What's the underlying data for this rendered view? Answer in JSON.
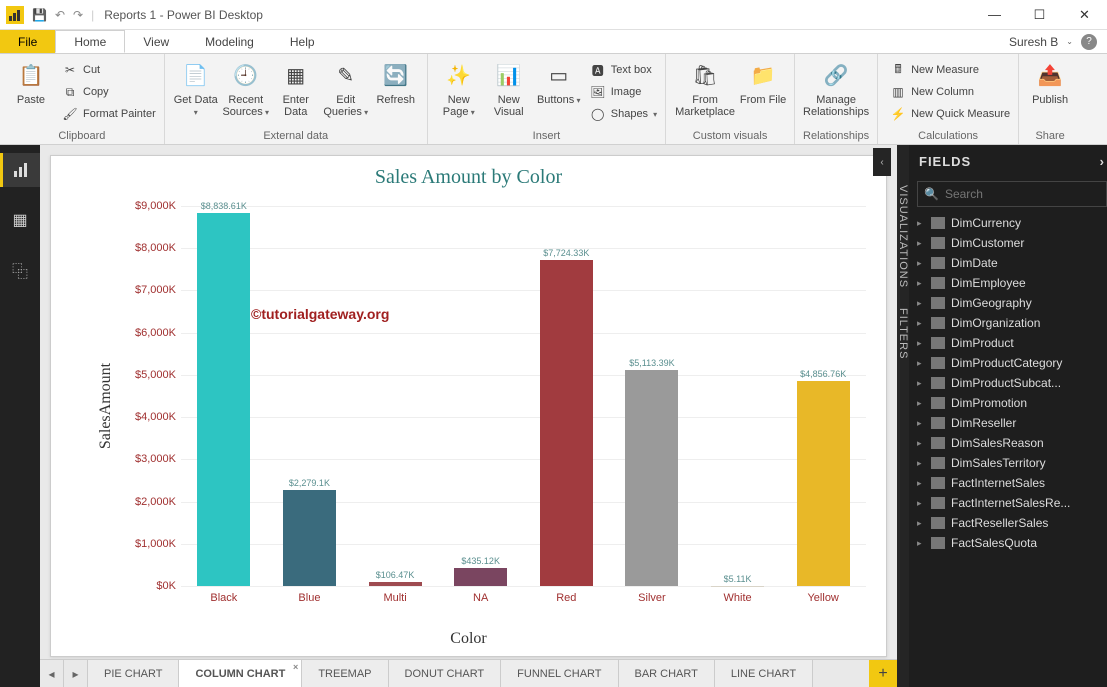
{
  "title": "Reports 1 - Power BI Desktop",
  "user": "Suresh B",
  "menu": {
    "file": "File",
    "tabs": [
      "Home",
      "View",
      "Modeling",
      "Help"
    ],
    "active": "Home"
  },
  "ribbon": {
    "clipboard": {
      "label": "Clipboard",
      "paste": "Paste",
      "cut": "Cut",
      "copy": "Copy",
      "painter": "Format Painter"
    },
    "external": {
      "label": "External data",
      "get": "Get Data",
      "recent": "Recent Sources",
      "enter": "Enter Data",
      "edit": "Edit Queries",
      "refresh": "Refresh"
    },
    "insert": {
      "label": "Insert",
      "page": "New Page",
      "visual": "New Visual",
      "buttons": "Buttons",
      "textbox": "Text box",
      "image": "Image",
      "shapes": "Shapes"
    },
    "custom": {
      "label": "Custom visuals",
      "market": "From Marketplace",
      "file": "From File"
    },
    "rel": {
      "label": "Relationships",
      "manage": "Manage Relationships"
    },
    "calc": {
      "label": "Calculations",
      "measure": "New Measure",
      "column": "New Column",
      "quick": "New Quick Measure"
    },
    "share": {
      "label": "Share",
      "publish": "Publish"
    }
  },
  "chart_data": {
    "type": "bar",
    "title": "Sales Amount by Color",
    "xlabel": "Color",
    "ylabel": "SalesAmount",
    "ylim": [
      0,
      9000
    ],
    "yticks": [
      "$0K",
      "$1,000K",
      "$2,000K",
      "$3,000K",
      "$4,000K",
      "$5,000K",
      "$6,000K",
      "$7,000K",
      "$8,000K",
      "$9,000K"
    ],
    "categories": [
      "Black",
      "Blue",
      "Multi",
      "NA",
      "Red",
      "Silver",
      "White",
      "Yellow"
    ],
    "values": [
      8838.61,
      2279.1,
      106.47,
      435.12,
      7724.33,
      5113.39,
      5.11,
      4856.76
    ],
    "data_labels": [
      "$8,838.61K",
      "$2,279.1K",
      "$106.47K",
      "$435.12K",
      "$7,724.33K",
      "$5,113.39K",
      "$5.11K",
      "$4,856.76K"
    ],
    "colors": [
      "#2dc5c2",
      "#3a6b7d",
      "#9e4b50",
      "#7a4560",
      "#a13b3f",
      "#9a9a9a",
      "#d9d4c8",
      "#e8b828"
    ]
  },
  "watermark": "©tutorialgateway.org",
  "page_tabs": [
    "PIE CHART",
    "COLUMN CHART",
    "TREEMAP",
    "DONUT CHART",
    "FUNNEL CHART",
    "BAR CHART",
    "LINE CHART"
  ],
  "active_page_tab": "COLUMN CHART",
  "fields": {
    "header": "FIELDS",
    "search_placeholder": "Search",
    "tables": [
      "DimCurrency",
      "DimCustomer",
      "DimDate",
      "DimEmployee",
      "DimGeography",
      "DimOrganization",
      "DimProduct",
      "DimProductCategory",
      "DimProductSubcat...",
      "DimPromotion",
      "DimReseller",
      "DimSalesReason",
      "DimSalesTerritory",
      "FactInternetSales",
      "FactInternetSalesRe...",
      "FactResellerSales",
      "FactSalesQuota"
    ]
  },
  "side_tabs": [
    "VISUALIZATIONS",
    "FILTERS"
  ]
}
